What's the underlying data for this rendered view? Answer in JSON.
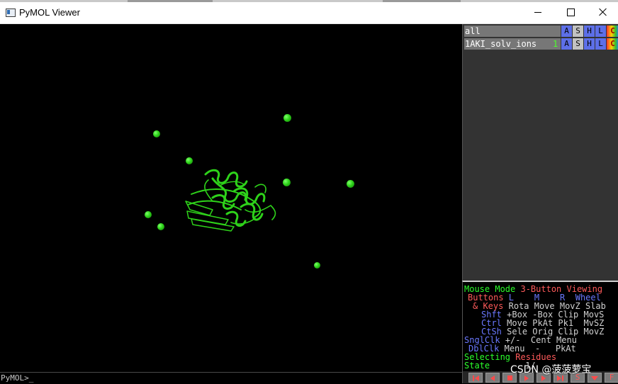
{
  "window": {
    "title": "PyMOL Viewer",
    "icon": "pymol-app-icon",
    "controls": [
      "minimize-icon",
      "maximize-icon",
      "close-icon"
    ]
  },
  "viewport": {
    "background": "#000000",
    "ion_color": "#2ed21a",
    "cartoon_color": "#2ed21a"
  },
  "command_line": {
    "prompt": "PyMOL>_"
  },
  "objects": [
    {
      "name": "all",
      "state": "",
      "buttons": [
        "A",
        "S",
        "H",
        "L",
        "C"
      ]
    },
    {
      "name": "1AKI_solv_ions",
      "state": "1",
      "buttons": [
        "A",
        "S",
        "H",
        "L",
        "C"
      ]
    }
  ],
  "mouse_panel": {
    "line1_a": "Mouse Mode",
    "line1_b": "3-Button Viewing",
    "line2_a": "Buttons",
    "line2_b": " L    M    R  Wheel",
    "line3_a": "& Keys",
    "line3_b": "Rota Move MovZ Slab",
    "line4_a": "Shft",
    "line4_b": "+Box -Box Clip MovS",
    "line5_a": "Ctrl",
    "line5_b": "Move PkAt Pk1  MvSZ",
    "line6_a": "CtSh",
    "line6_b": "Sele Orig Clip MovZ",
    "line7_a": "SnglClk",
    "line7_b": "+/-  Cent Menu",
    "line8_a": "DblClk",
    "line8_b": "Menu  -   PkAt",
    "line9_a": "Selecting",
    "line9_b": "Residues",
    "line10_a": "State",
    "line10_b": "1/"
  },
  "playback": {
    "buttons": [
      "rewind-icon",
      "step-back-icon",
      "stop-icon",
      "play-icon",
      "step-forward-icon",
      "forward-end-icon",
      "S",
      "sculpt-down-icon",
      "F"
    ]
  },
  "watermark": "CSDN @菠菠萝宝"
}
